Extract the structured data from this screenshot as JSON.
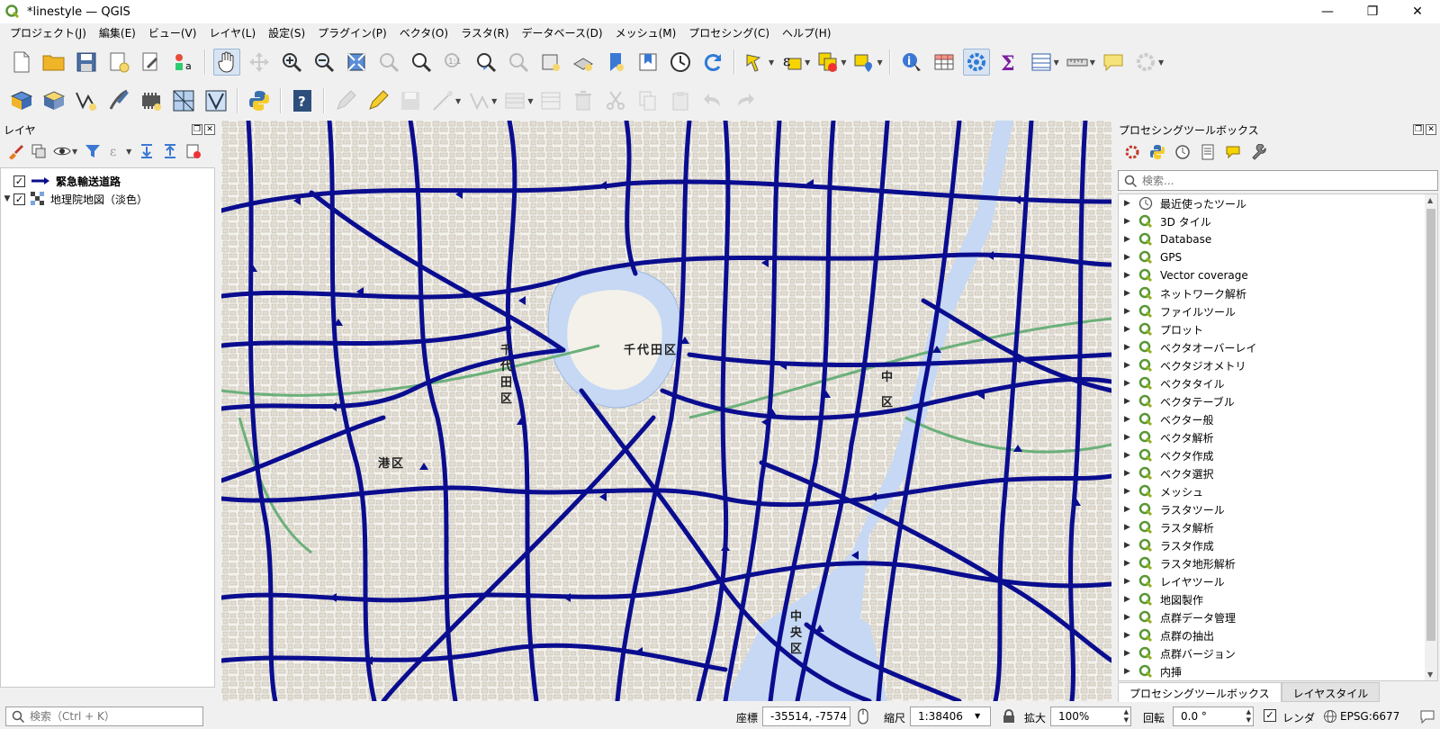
{
  "window": {
    "title": "*linestyle — QGIS"
  },
  "menu": [
    "プロジェクト(J)",
    "編集(E)",
    "ビュー(V)",
    "レイヤ(L)",
    "設定(S)",
    "プラグイン(P)",
    "ベクタ(O)",
    "ラスタ(R)",
    "データベース(D)",
    "メッシュ(M)",
    "プロセシング(C)",
    "ヘルプ(H)"
  ],
  "layers_panel": {
    "title": "レイヤ",
    "layers": [
      {
        "name": "緊急輸送道路",
        "checked": true,
        "bold": true
      },
      {
        "name": "地理院地図（淡色）",
        "checked": true,
        "bold": false
      }
    ]
  },
  "map": {
    "labels": [
      {
        "text": "千代田区"
      },
      {
        "text": "千"
      },
      {
        "text": "代"
      },
      {
        "text": "田"
      },
      {
        "text": "区"
      },
      {
        "text": "港区"
      },
      {
        "text": "中"
      },
      {
        "text": "区"
      },
      {
        "text": "中"
      },
      {
        "text": "央"
      },
      {
        "text": "区"
      }
    ],
    "colors": {
      "road": "#0a0d8f",
      "water": "#c6d8f3",
      "base": "#f6f4ef",
      "park": "#cfe3c3"
    }
  },
  "processing": {
    "title": "プロセシングツールボックス",
    "search_placeholder": "検索...",
    "items": [
      {
        "label": "最近使ったツール",
        "icon": "clock-icon"
      },
      {
        "label": "3D タイル",
        "icon": "qgis-logo-icon"
      },
      {
        "label": "Database",
        "icon": "qgis-logo-icon"
      },
      {
        "label": "GPS",
        "icon": "qgis-logo-icon"
      },
      {
        "label": "Vector coverage",
        "icon": "qgis-logo-icon"
      },
      {
        "label": "ネットワーク解析",
        "icon": "qgis-logo-icon"
      },
      {
        "label": "ファイルツール",
        "icon": "qgis-logo-icon"
      },
      {
        "label": "プロット",
        "icon": "qgis-logo-icon"
      },
      {
        "label": "ベクタオーバーレイ",
        "icon": "qgis-logo-icon"
      },
      {
        "label": "ベクタジオメトリ",
        "icon": "qgis-logo-icon"
      },
      {
        "label": "ベクタタイル",
        "icon": "qgis-logo-icon"
      },
      {
        "label": "ベクタテーブル",
        "icon": "qgis-logo-icon"
      },
      {
        "label": "ベクター般",
        "icon": "qgis-logo-icon"
      },
      {
        "label": "ベクタ解析",
        "icon": "qgis-logo-icon"
      },
      {
        "label": "ベクタ作成",
        "icon": "qgis-logo-icon"
      },
      {
        "label": "ベクタ選択",
        "icon": "qgis-logo-icon"
      },
      {
        "label": "メッシュ",
        "icon": "qgis-logo-icon"
      },
      {
        "label": "ラスタツール",
        "icon": "qgis-logo-icon"
      },
      {
        "label": "ラスタ解析",
        "icon": "qgis-logo-icon"
      },
      {
        "label": "ラスタ作成",
        "icon": "qgis-logo-icon"
      },
      {
        "label": "ラスタ地形解析",
        "icon": "qgis-logo-icon"
      },
      {
        "label": "レイヤツール",
        "icon": "qgis-logo-icon"
      },
      {
        "label": "地図製作",
        "icon": "qgis-logo-icon"
      },
      {
        "label": "点群データ管理",
        "icon": "qgis-logo-icon"
      },
      {
        "label": "点群の抽出",
        "icon": "qgis-logo-icon"
      },
      {
        "label": "点群バージョン",
        "icon": "qgis-logo-icon"
      },
      {
        "label": "内挿",
        "icon": "qgis-logo-icon"
      }
    ],
    "tabs": [
      "プロセシングツールボックス",
      "レイヤスタイル"
    ]
  },
  "statusbar": {
    "search_placeholder": "検索（Ctrl + K）",
    "coord_label": "座標",
    "coord_value": "-35514, -7574",
    "scale_label": "縮尺",
    "scale_value": "1:38406",
    "magnifier_label": "拡大",
    "magnifier_value": "100%",
    "rotation_label": "回転",
    "rotation_value": "0.0 °",
    "render_label": "レンダ",
    "render_checked": true,
    "crs": "EPSG:6677"
  }
}
